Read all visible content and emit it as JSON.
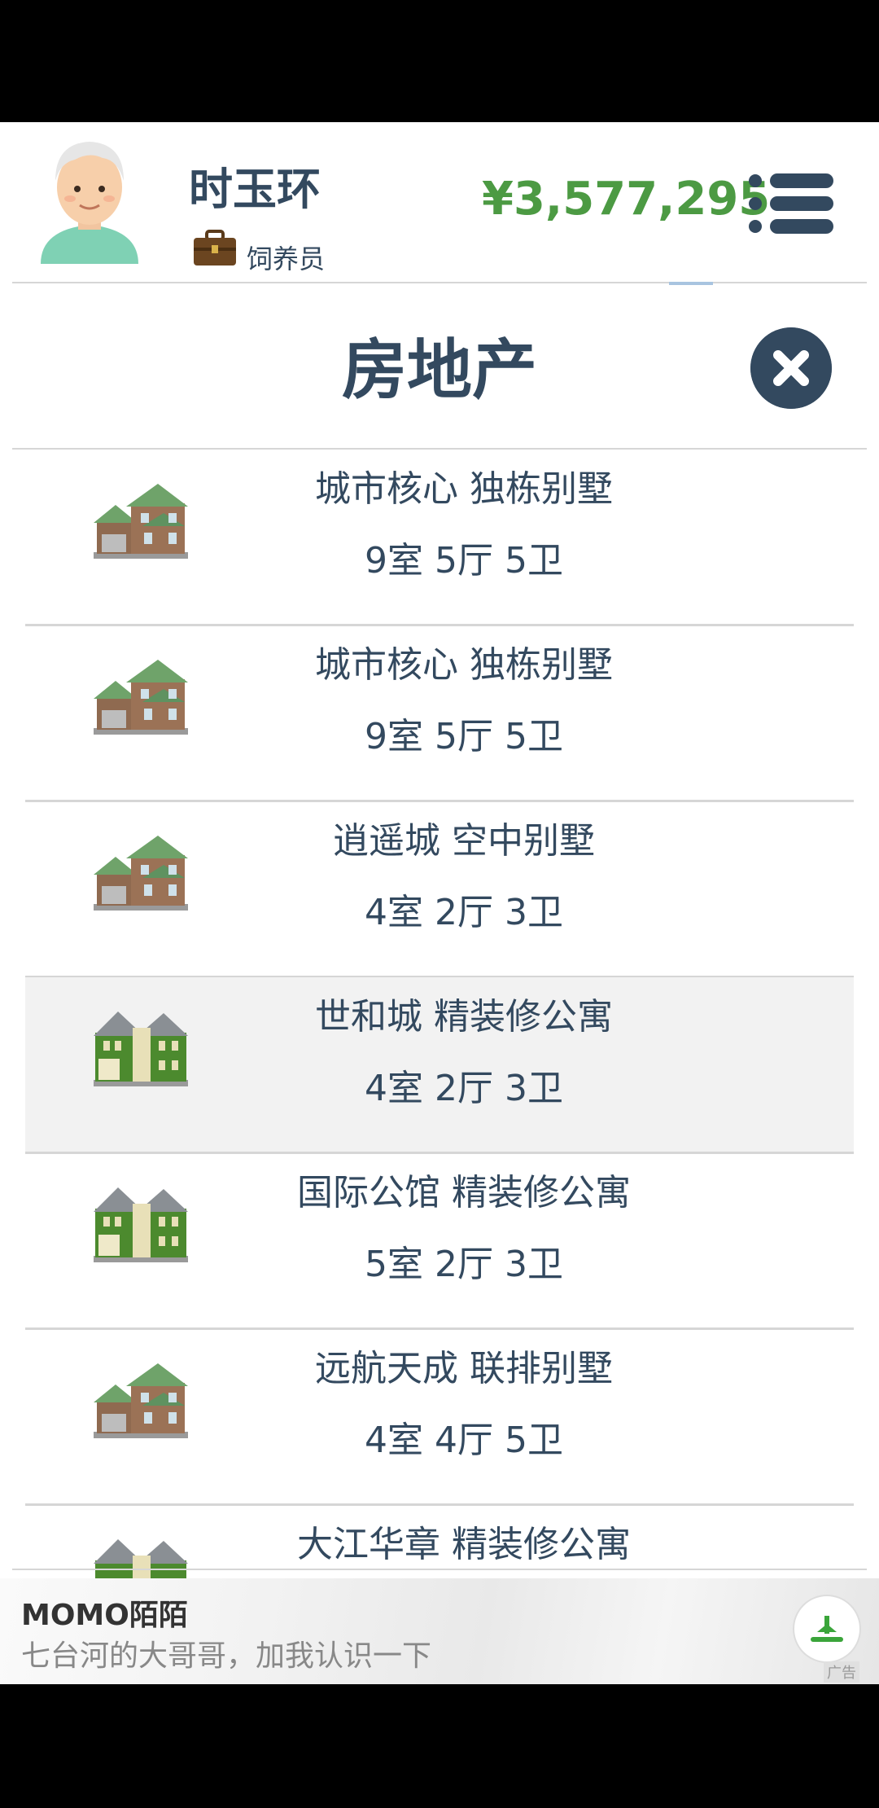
{
  "header": {
    "player_name": "时玉环",
    "job": "饲养员",
    "money": "¥3,577,295",
    "menu_icon": "menu-icon"
  },
  "panel": {
    "title": "房地产",
    "close_icon": "close-icon"
  },
  "properties": [
    {
      "name": "城市核心 独栋别墅",
      "layout": "9室 5厅 5卫",
      "icon": "brown-house"
    },
    {
      "name": "城市核心 独栋别墅",
      "layout": "9室 5厅 5卫",
      "icon": "brown-house"
    },
    {
      "name": "逍遥城 空中别墅",
      "layout": "4室 2厅 3卫",
      "icon": "brown-house"
    },
    {
      "name": "世和城 精装修公寓",
      "layout": "4室 2厅 3卫",
      "icon": "green-house",
      "selected": true
    },
    {
      "name": "国际公馆 精装修公寓",
      "layout": "5室 2厅 3卫",
      "icon": "green-house"
    },
    {
      "name": "远航天成 联排别墅",
      "layout": "4室 4厅 5卫",
      "icon": "brown-house"
    },
    {
      "name": "大江华章 精装修公寓",
      "layout": "",
      "icon": "green-house"
    }
  ],
  "ad": {
    "title": "MOMO陌陌",
    "text": "七台河的大哥哥，加我认识一下",
    "tag": "广告"
  },
  "colors": {
    "text": "#33495f",
    "money": "#4c9a43",
    "selected_row": "#f2f2f2"
  }
}
